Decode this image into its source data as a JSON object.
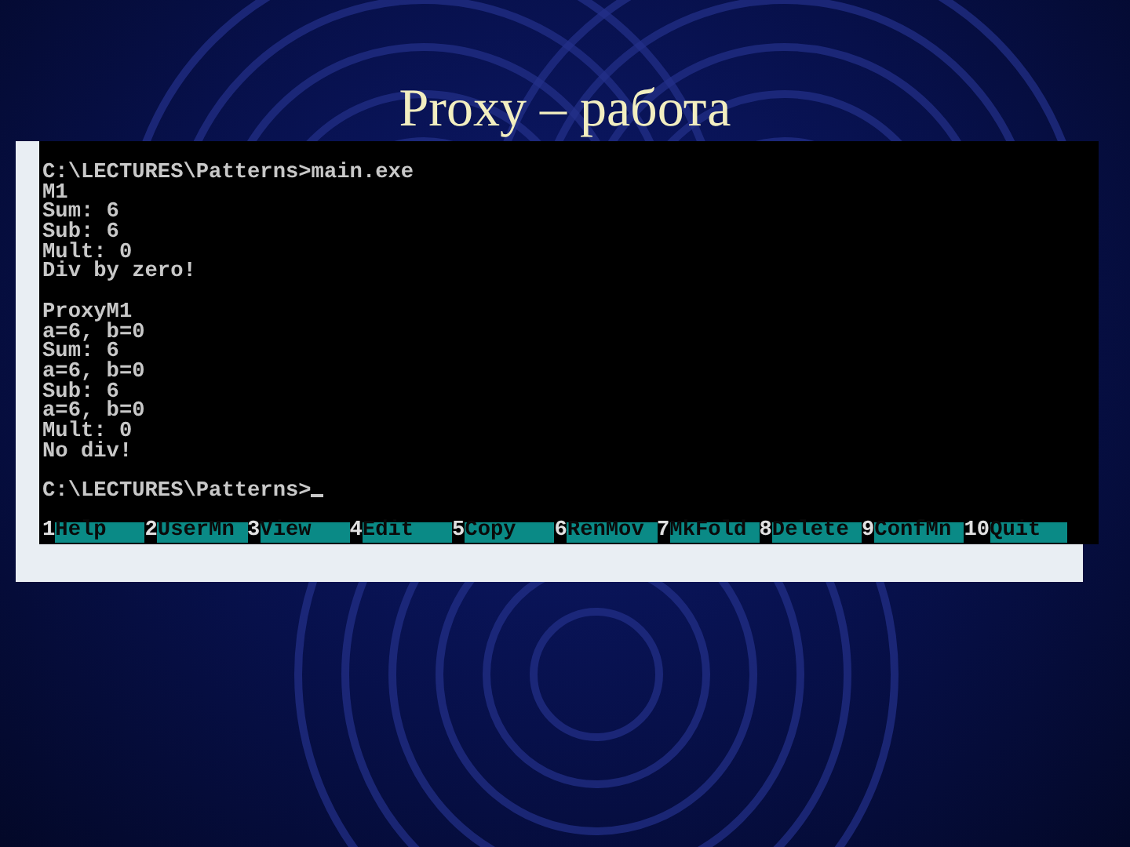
{
  "slide": {
    "title": "Proxy – работа"
  },
  "console": {
    "blocks": [
      [
        "C:\\LECTURES\\Patterns>main.exe",
        "M1",
        "Sum: 6",
        "Sub: 6",
        "Mult: 0",
        "Div by zero!"
      ],
      [
        "ProxyM1",
        "a=6, b=0",
        "Sum: 6",
        "a=6, b=0",
        "Sub: 6",
        "a=6, b=0",
        "Mult: 0",
        "No div!"
      ],
      [
        "C:\\LECTURES\\Patterns>"
      ]
    ],
    "cursor": true,
    "function_keys": [
      {
        "number": "1",
        "label": "Help"
      },
      {
        "number": "2",
        "label": "UserMn"
      },
      {
        "number": "3",
        "label": "View"
      },
      {
        "number": "4",
        "label": "Edit"
      },
      {
        "number": "5",
        "label": "Copy"
      },
      {
        "number": "6",
        "label": "RenMov"
      },
      {
        "number": "7",
        "label": "MkFold"
      },
      {
        "number": "8",
        "label": "Delete"
      },
      {
        "number": "9",
        "label": "ConfMn"
      },
      {
        "number": "10",
        "label": "Quit"
      }
    ]
  }
}
